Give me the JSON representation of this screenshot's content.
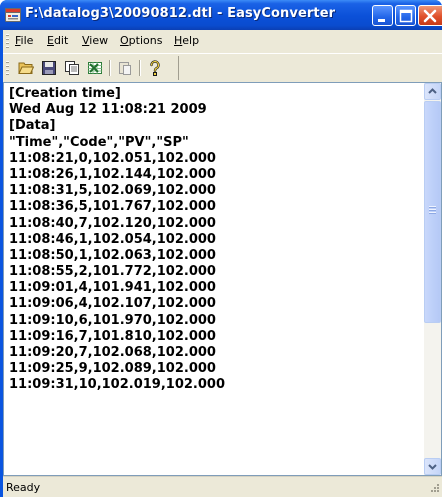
{
  "window": {
    "title": "F:\\datalog3\\20090812.dtl - EasyConverter"
  },
  "menu": [
    {
      "label": "File",
      "hotkey": "F"
    },
    {
      "label": "Edit",
      "hotkey": "E"
    },
    {
      "label": "View",
      "hotkey": "V"
    },
    {
      "label": "Options",
      "hotkey": "O"
    },
    {
      "label": "Help",
      "hotkey": "H"
    }
  ],
  "toolbar": {
    "icons": [
      "open-folder-icon",
      "save-icon",
      "copy-icon",
      "excel-export-icon",
      "paste-icon",
      "help-icon"
    ]
  },
  "document": {
    "lines": [
      "[Creation time]",
      "Wed Aug 12 11:08:21 2009",
      "[Data]",
      "\"Time\",\"Code\",\"PV\",\"SP\"",
      "11:08:21,0,102.051,102.000",
      "11:08:26,1,102.144,102.000",
      "11:08:31,5,102.069,102.000",
      "11:08:36,5,101.767,102.000",
      "11:08:40,7,102.120,102.000",
      "11:08:46,1,102.054,102.000",
      "11:08:50,1,102.063,102.000",
      "11:08:55,2,101.772,102.000",
      "11:09:01,4,101.941,102.000",
      "11:09:06,4,102.107,102.000",
      "11:09:10,6,101.970,102.000",
      "11:09:16,7,101.810,102.000",
      "11:09:20,7,102.068,102.000",
      "11:09:25,9,102.089,102.000",
      "11:09:31,10,102.019,102.000"
    ]
  },
  "status": {
    "text": "Ready"
  },
  "colors": {
    "titlebar": "#0a4ccf",
    "chrome": "#ece9d8",
    "close_button": "#e0502a",
    "scrollbar": "#c5d5f8"
  }
}
